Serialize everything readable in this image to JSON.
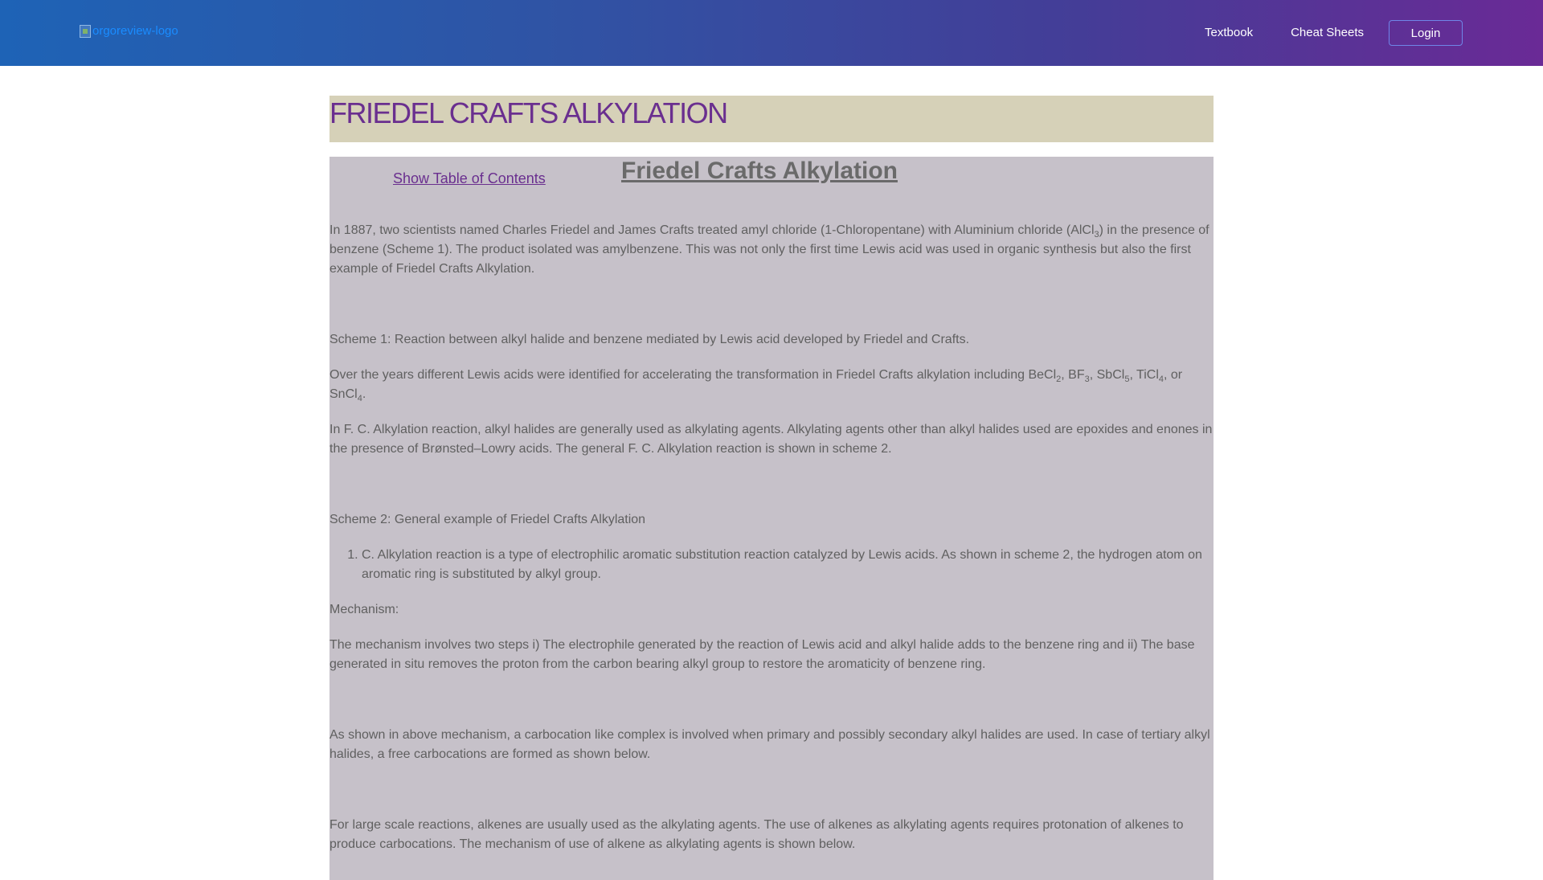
{
  "header": {
    "logo_alt": "orgoreview-logo",
    "nav": {
      "textbook": "Textbook",
      "cheat_sheets": "Cheat Sheets",
      "login": "Login"
    }
  },
  "page": {
    "banner_title": "FRIEDEL CRAFTS ALKYLATION",
    "toc_link": "Show Table of Contents",
    "article_title": "Friedel Crafts Alkylation"
  },
  "article": {
    "p1": {
      "a": "In 1887, two scientists named Charles Friedel and James Crafts treated amyl chloride (1-Chloropentane) with Aluminium chloride (AlCl",
      "sub": "3",
      "b": ") in the presence of benzene (Scheme 1). The product isolated was amylbenzene. This was not only the first time Lewis acid was used in organic synthesis but also the first example of Friedel Crafts Alkylation."
    },
    "scheme1": "Scheme 1: Reaction between alkyl halide and benzene mediated by Lewis acid developed by Friedel and Crafts.",
    "p2": {
      "a": "Over the years different Lewis acids were identified for accelerating the transformation in Friedel Crafts alkylation including BeCl",
      "s1": "2",
      "b": ", BF",
      "s2": "3",
      "c": ", SbCl",
      "s3": "5",
      "d": ", TiCl",
      "s4": "4",
      "e": ", or SnCl",
      "s5": "4",
      "f": "."
    },
    "p3": "In F. C. Alkylation reaction, alkyl halides are generally used as alkylating agents. Alkylating agents other than alkyl halides used are epoxides and enones in the presence of Brønsted–Lowry acids. The general F. C. Alkylation reaction is shown in scheme 2.",
    "scheme2": "Scheme 2: General example of Friedel Crafts Alkylation",
    "list_item": "C. Alkylation reaction is a type of electrophilic aromatic substitution reaction catalyzed by Lewis acids. As shown in scheme 2, the hydrogen atom on aromatic ring is substituted by alkyl group.",
    "mechanism_label": "Mechanism:",
    "p4": "The mechanism involves two steps i) The electrophile generated by the reaction of Lewis acid and alkyl halide adds to the benzene ring and ii) The base generated in situ removes the proton from the carbon bearing alkyl group to restore the aromaticity of benzene ring.",
    "p5": "As shown in above mechanism, a carbocation like complex is involved when primary and possibly secondary alkyl halides are used. In case of tertiary alkyl halides, a free carbocations are formed as shown below.",
    "p6": "For large scale reactions, alkenes are usually used as the alkylating agents. The use of alkenes as alkylating agents requires protonation of alkenes to produce carbocations. The mechanism of use of alkene as alkylating agents is shown below."
  }
}
